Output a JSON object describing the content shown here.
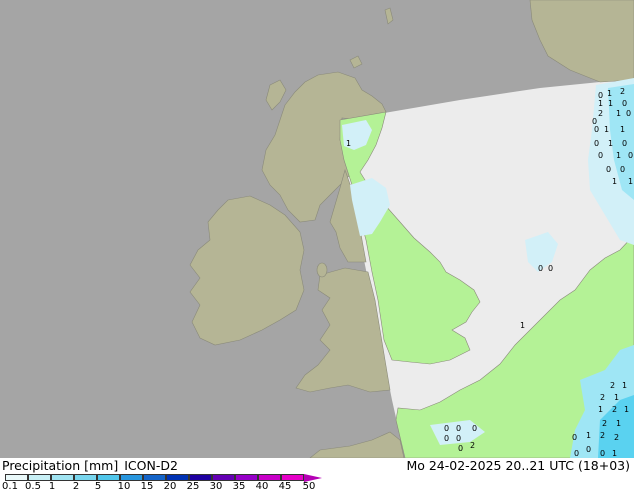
{
  "map": {
    "colors": {
      "sea_out_of_domain": "#a5a5a5",
      "land_out_of_domain": "#b5b595",
      "sea_in_domain": "#ececec",
      "land_in_domain": "#b4f296",
      "light_precip": "#d2f0f8",
      "med_precip": "#9fe6f5",
      "strong_precip": "#5ad2f0",
      "coast": "#8a8a7a"
    },
    "value_labels": [
      {
        "text": "0"
      },
      {
        "text": "1"
      },
      {
        "text": "2"
      },
      {
        "text": "1"
      },
      {
        "text": "0"
      },
      {
        "text": "1"
      },
      {
        "text": "0"
      },
      {
        "text": "2"
      },
      {
        "text": "1"
      },
      {
        "text": "0"
      },
      {
        "text": "0"
      },
      {
        "text": "1"
      },
      {
        "text": "1"
      },
      {
        "text": "0"
      },
      {
        "text": "1"
      },
      {
        "text": "0"
      },
      {
        "text": "0"
      },
      {
        "text": "1"
      },
      {
        "text": "0"
      },
      {
        "text": "0"
      },
      {
        "text": "0"
      },
      {
        "text": "1"
      },
      {
        "text": "1"
      },
      {
        "text": "2"
      },
      {
        "text": "1"
      },
      {
        "text": "2"
      },
      {
        "text": "1"
      },
      {
        "text": "1"
      },
      {
        "text": "2"
      },
      {
        "text": "1"
      },
      {
        "text": "2"
      },
      {
        "text": "1"
      },
      {
        "text": "1"
      },
      {
        "text": "2"
      },
      {
        "text": "0"
      },
      {
        "text": "2"
      },
      {
        "text": "0"
      },
      {
        "text": "0"
      },
      {
        "text": "0"
      },
      {
        "text": "1"
      },
      {
        "text": "0"
      },
      {
        "text": "0"
      },
      {
        "text": "0"
      },
      {
        "text": "0"
      },
      {
        "text": "0"
      },
      {
        "text": "0"
      },
      {
        "text": "1"
      },
      {
        "text": "1"
      },
      {
        "text": "0"
      },
      {
        "text": "0"
      },
      {
        "text": "2"
      }
    ]
  },
  "footer": {
    "label": "Precipitation [mm]",
    "model": "ICON-D2",
    "datetime": "Mo 24-02-2025 20..21 UTC (18+03)"
  },
  "legend": {
    "colors": [
      "#eaf9fa",
      "#c8f0f6",
      "#a0e4f2",
      "#78d6ee",
      "#50c6ea",
      "#2896de",
      "#1464c8",
      "#0032b4",
      "#1e00a0",
      "#6400b4",
      "#9600c8",
      "#c800c8",
      "#e600c8",
      "#b400b4"
    ],
    "ticks": [
      "0.1",
      "0.5",
      "1",
      "2",
      "5",
      "10",
      "15",
      "20",
      "25",
      "30",
      "35",
      "40",
      "45",
      "50"
    ]
  }
}
